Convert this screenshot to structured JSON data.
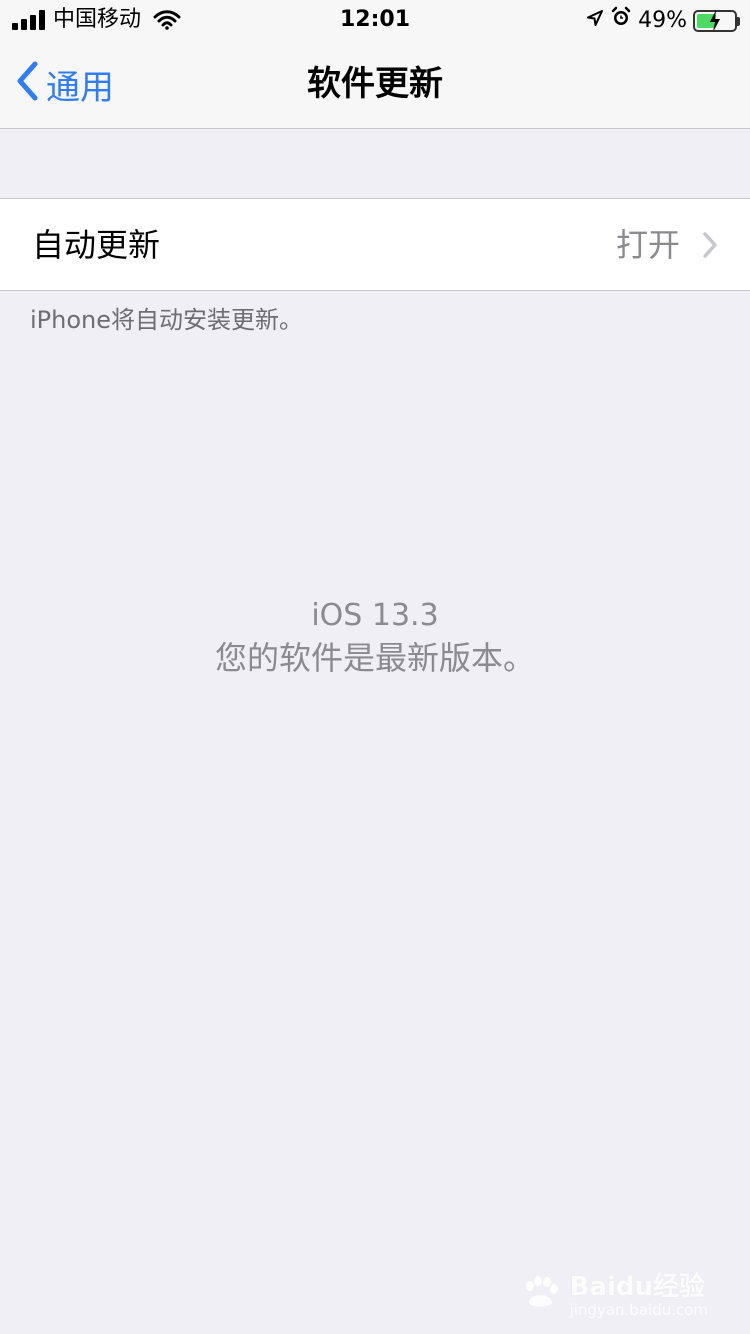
{
  "status_bar": {
    "carrier": "中国移动",
    "time": "12:01",
    "battery": "49%"
  },
  "nav": {
    "back_label": "通用",
    "title": "软件更新"
  },
  "settings": {
    "auto_update_label": "自动更新",
    "auto_update_value": "打开"
  },
  "footer": {
    "description": "iPhone将自动安装更新。"
  },
  "version": {
    "name": "iOS 13.3",
    "status": "您的软件是最新版本。"
  },
  "watermark": {
    "main": "Baidu经验",
    "sub": "jingyan.baidu.com"
  },
  "colors": {
    "accent": "#2f7cf6",
    "background": "#f0eff5",
    "battery": "#4cd964"
  }
}
